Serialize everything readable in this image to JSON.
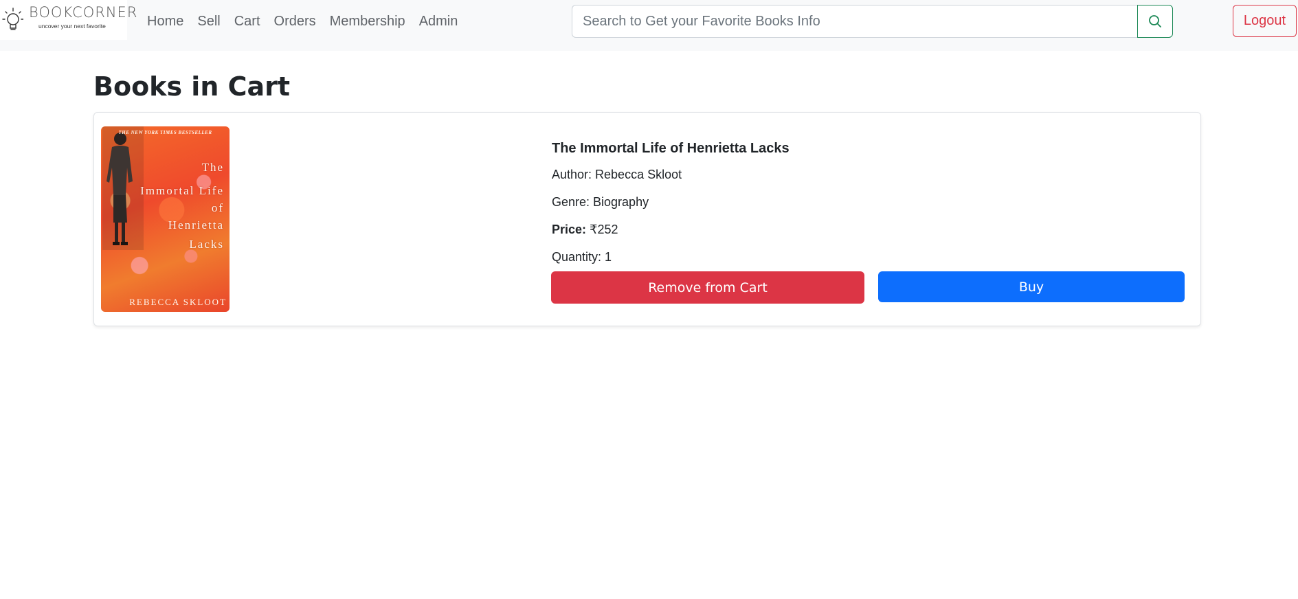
{
  "navbar": {
    "logo": {
      "brand": "BOOKCORNER",
      "tagline": "uncover your next favorite"
    },
    "links": [
      "Home",
      "Sell",
      "Cart",
      "Orders",
      "Membership",
      "Admin"
    ],
    "search": {
      "placeholder": "Search to Get your Favorite Books Info",
      "value": ""
    },
    "logout_label": "Logout"
  },
  "page": {
    "title": "Books in Cart"
  },
  "cart": {
    "items": [
      {
        "cover": {
          "banner": "THE NEW YORK TIMES BESTSELLER",
          "title_lines": [
            "The",
            "Immortal Life",
            "of",
            "Henrietta",
            "Lacks"
          ],
          "author": "REBECCA SKLOOT"
        },
        "title": "The Immortal Life of Henrietta Lacks",
        "author_line": "Author: Rebecca Skloot",
        "genre_line": "Genre: Biography",
        "price_label": "Price:",
        "price_value": "₹252",
        "quantity_line": "Quantity: 1",
        "remove_label": "Remove from Cart",
        "buy_label": "Buy"
      }
    ]
  },
  "colors": {
    "danger": "#dc3545",
    "primary": "#0d6efd",
    "success": "#198754",
    "navbar_bg": "#f8f9fa"
  },
  "icons": {
    "search": "search-icon",
    "logo": "lightbulb-icon"
  }
}
